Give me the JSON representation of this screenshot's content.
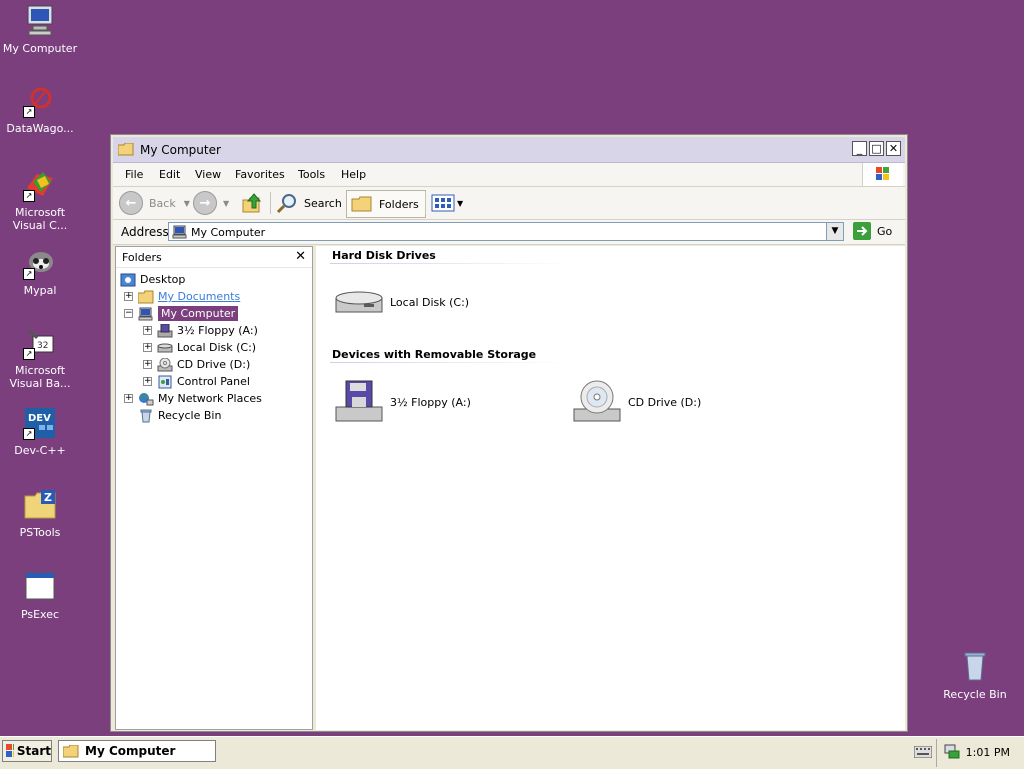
{
  "desktop": {
    "icons": [
      {
        "label": "My Computer",
        "icon": "my-computer-icon"
      },
      {
        "label": "DataWago...",
        "icon": "datawagon-icon"
      },
      {
        "label": "Microsoft Visual C...",
        "icon": "visual-cpp-icon"
      },
      {
        "label": "Mypal",
        "icon": "mypal-icon"
      },
      {
        "label": "Microsoft Visual Ba...",
        "icon": "visual-basic-icon"
      },
      {
        "label": "Dev-C++",
        "icon": "dev-cpp-icon"
      },
      {
        "label": "PSTools",
        "icon": "pstools-icon"
      },
      {
        "label": "PsExec",
        "icon": "psexec-icon"
      },
      {
        "label": "Recycle Bin",
        "icon": "recycle-bin-icon"
      }
    ]
  },
  "window": {
    "title": "My Computer",
    "menu": [
      "File",
      "Edit",
      "View",
      "Favorites",
      "Tools",
      "Help"
    ],
    "toolbar": {
      "back": "Back",
      "search": "Search",
      "folders": "Folders"
    },
    "address": {
      "label": "Address",
      "value": "My Computer",
      "go": "Go"
    },
    "folders_pane": {
      "title": "Folders",
      "tree": [
        {
          "label": "Desktop"
        },
        {
          "label": "My Documents"
        },
        {
          "label": "My Computer"
        },
        {
          "label": "3½ Floppy (A:)"
        },
        {
          "label": "Local Disk (C:)"
        },
        {
          "label": "CD Drive (D:)"
        },
        {
          "label": "Control Panel"
        },
        {
          "label": "My Network Places"
        },
        {
          "label": "Recycle Bin"
        }
      ]
    },
    "content": {
      "groups": [
        {
          "title": "Hard Disk Drives",
          "items": [
            "Local Disk (C:)"
          ]
        },
        {
          "title": "Devices with Removable Storage",
          "items": [
            "3½ Floppy (A:)",
            "CD Drive (D:)"
          ]
        }
      ]
    }
  },
  "taskbar": {
    "start": "Start",
    "task": "My Computer",
    "clock": "1:01 PM"
  },
  "colors": {
    "desktop": "#7b3f7e",
    "selection": "#7b3f7e"
  }
}
